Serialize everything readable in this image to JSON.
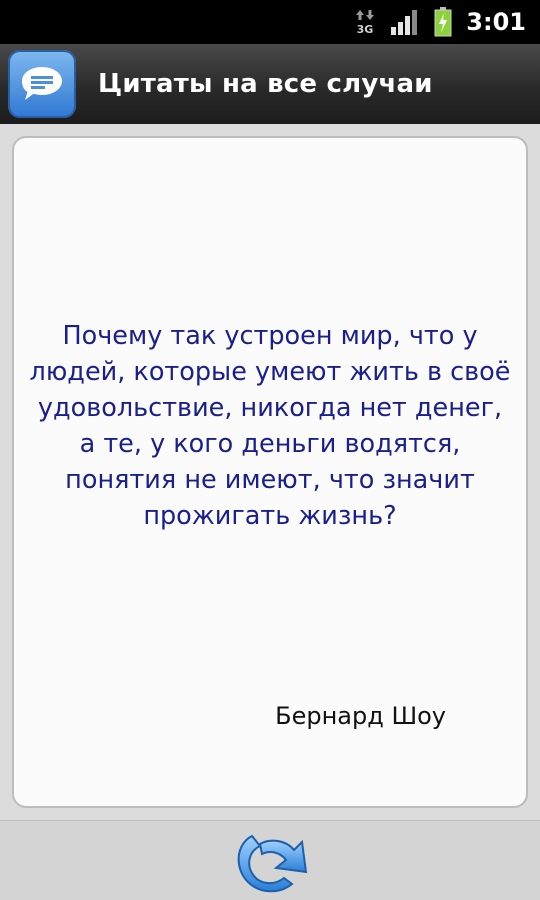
{
  "status_bar": {
    "network": "3G",
    "time": "3:01",
    "icons": [
      "network-3g-icon",
      "signal-strength-icon",
      "battery-charging-icon"
    ]
  },
  "app": {
    "title": "Цитаты на все случаи",
    "icon": "chat-bubble-icon"
  },
  "quote": {
    "text": "Почему так устроен мир, что у людей, которые умеют жить в своё удовольствие, никогда нет денег, а те, у кого деньги водятся, понятия не имеют, что значит прожигать жизнь?",
    "author": "Бернард Шоу"
  },
  "toolbar": {
    "refresh_icon": "refresh-icon"
  },
  "colors": {
    "quote_text": "#1a1f8c",
    "accent_blue": "#2f78d3",
    "battery_green": "#8bd33a"
  }
}
